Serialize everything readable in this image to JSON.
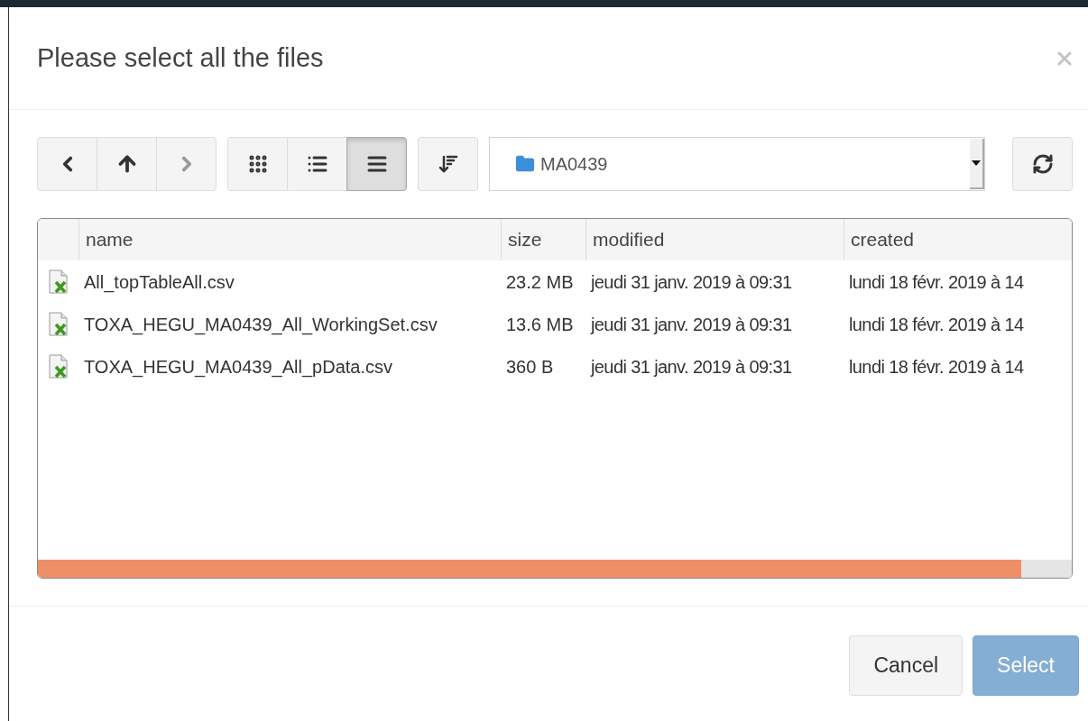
{
  "dialog": {
    "title": "Please select all the files"
  },
  "toolbar": {
    "nav_buttons": [
      {
        "kind": "back",
        "disabled": false
      },
      {
        "kind": "up",
        "disabled": false
      },
      {
        "kind": "forward",
        "disabled": true
      }
    ],
    "view_buttons": [
      {
        "kind": "icons",
        "selected": false
      },
      {
        "kind": "list",
        "selected": false
      },
      {
        "kind": "details",
        "selected": true
      }
    ],
    "path": "MA0439"
  },
  "table": {
    "columns": [
      "name",
      "size",
      "modified",
      "created"
    ],
    "rows": [
      {
        "name": "All_topTableAll.csv",
        "size": "23.2 MB",
        "modified": "jeudi 31 janv. 2019 à 09:31",
        "created": "lundi 18 févr. 2019 à 14"
      },
      {
        "name": "TOXA_HEGU_MA0439_All_WorkingSet.csv",
        "size": "13.6 MB",
        "modified": "jeudi 31 janv. 2019 à 09:31",
        "created": "lundi 18 févr. 2019 à 14"
      },
      {
        "name": "TOXA_HEGU_MA0439_All_pData.csv",
        "size": "360 B",
        "modified": "jeudi 31 janv. 2019 à 09:31",
        "created": "lundi 18 févr. 2019 à 14"
      }
    ]
  },
  "footer_buttons": [
    {
      "label": "Cancel",
      "kind": "secondary",
      "disabled": false
    },
    {
      "label": "Select",
      "kind": "primary",
      "disabled": true
    }
  ]
}
